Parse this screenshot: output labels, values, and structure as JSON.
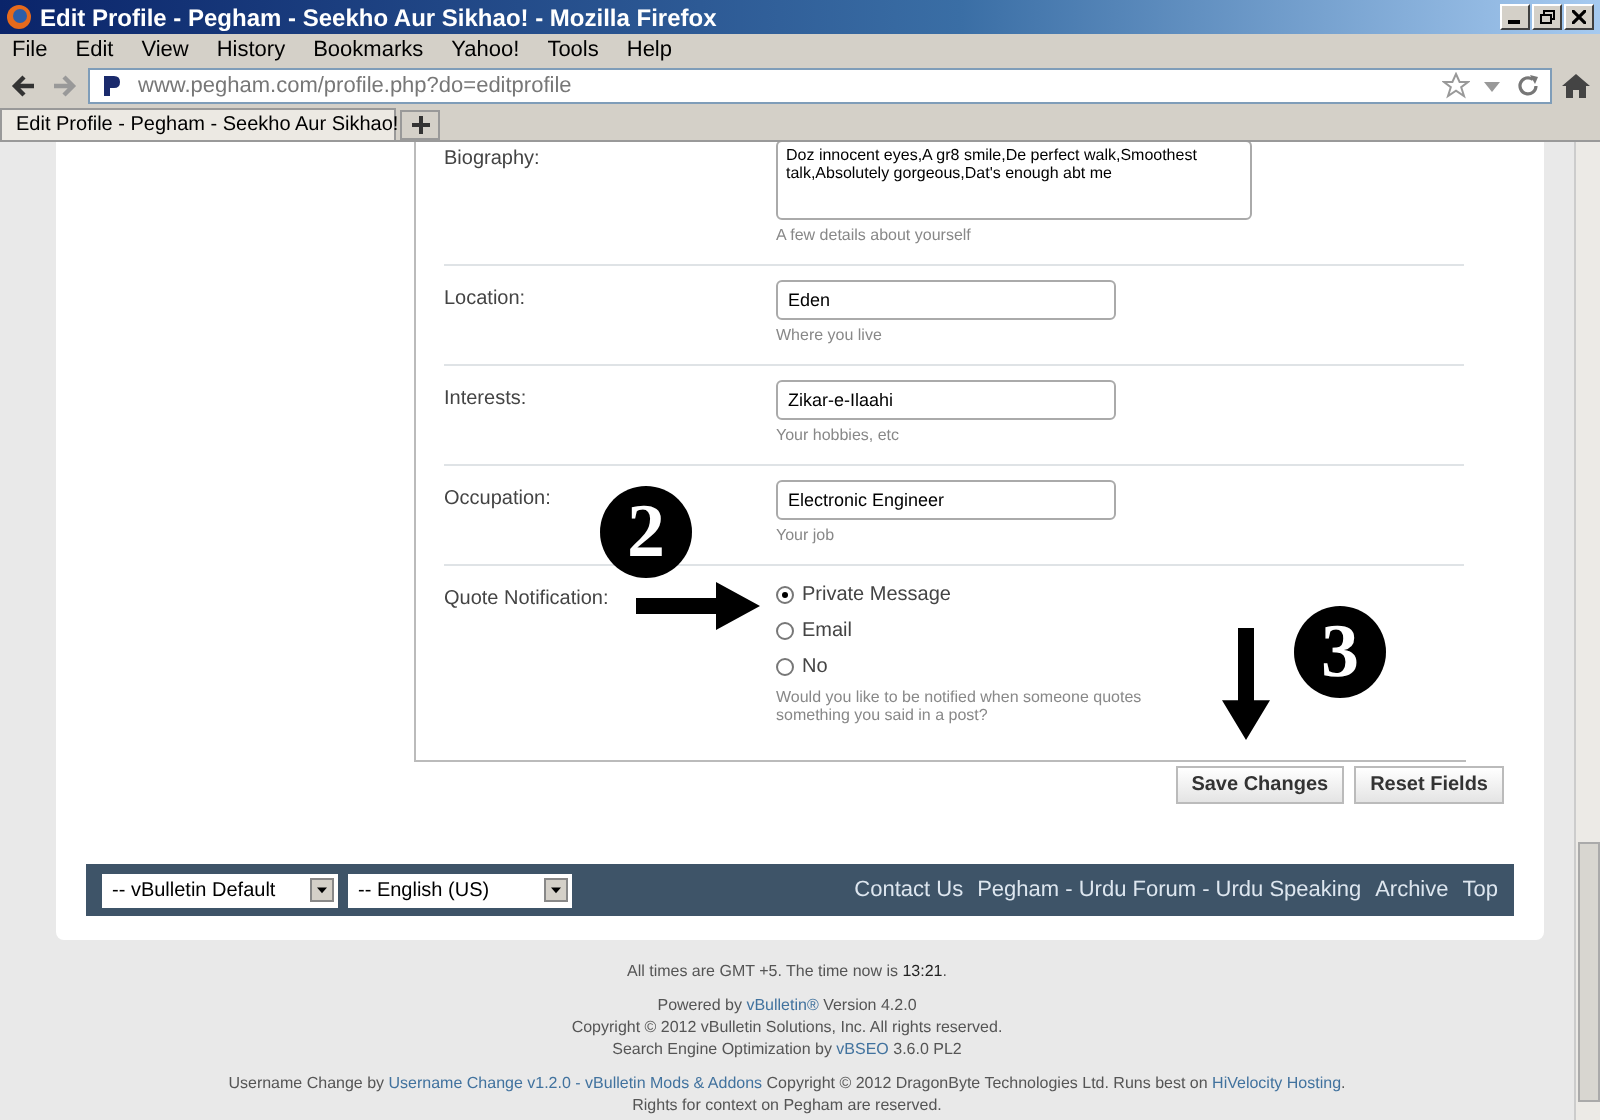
{
  "window": {
    "title": "Edit Profile - Pegham - Seekho Aur Sikhao! - Mozilla Firefox"
  },
  "menu": [
    "File",
    "Edit",
    "View",
    "History",
    "Bookmarks",
    "Yahoo!",
    "Tools",
    "Help"
  ],
  "address": {
    "url": "www.pegham.com/profile.php?do=editprofile"
  },
  "tabs": [
    {
      "label": "Edit Profile - Pegham - Seekho Aur Sikhao!",
      "selected": true
    }
  ],
  "form": {
    "rows": [
      {
        "kind": "textarea",
        "label": "Biography:",
        "value": "Doz innocent eyes,A gr8 smile,De perfect walk,Smoothest talk,Absolutely gorgeous,Dat's enough abt me",
        "hint": "A few details about yourself"
      },
      {
        "kind": "text",
        "label": "Location:",
        "value": "Eden",
        "hint": "Where you live"
      },
      {
        "kind": "text",
        "label": "Interests:",
        "value": "Zikar-e-Ilaahi",
        "hint": "Your hobbies, etc"
      },
      {
        "kind": "text",
        "label": "Occupation:",
        "value": "Electronic Engineer",
        "hint": "Your job"
      },
      {
        "kind": "radio",
        "label": "Quote Notification:",
        "options": [
          {
            "label": "Private Message",
            "selected": true
          },
          {
            "label": "Email",
            "selected": false
          },
          {
            "label": "No",
            "selected": false
          }
        ],
        "hint": "Would you like to be notified when someone quotes something you said in a post?"
      }
    ]
  },
  "buttons": [
    "Save Changes",
    "Reset Fields"
  ],
  "annotations": [
    {
      "number": "2"
    },
    {
      "number": "3"
    }
  ],
  "footer_bar": {
    "selects": [
      "-- vBulletin Default",
      "-- English (US)"
    ],
    "links": [
      "Contact Us",
      "Pegham - Urdu Forum - Urdu Speaking",
      "Archive",
      "Top"
    ]
  },
  "footer": {
    "time_note": "All times are GMT +5. The time now is **13:21**.",
    "lines": [
      [
        {
          "kind": "text",
          "text": "Powered by "
        },
        {
          "kind": "link",
          "text": "vBulletin®"
        },
        {
          "kind": "text",
          "text": " Version 4.2.0"
        }
      ],
      [
        {
          "kind": "text",
          "text": "Copyright © 2012 vBulletin Solutions, Inc. All rights reserved."
        }
      ],
      [
        {
          "kind": "text",
          "text": "Search Engine Optimization by "
        },
        {
          "kind": "link",
          "text": "vBSEO"
        },
        {
          "kind": "text",
          "text": " 3.6.0 PL2"
        }
      ],
      [
        {
          "kind": "text",
          "text": "Username Change by "
        },
        {
          "kind": "link",
          "text": "Username Change v1.2.0 - vBulletin Mods & Addons"
        },
        {
          "kind": "text",
          "text": " Copyright © 2012 DragonByte Technologies Ltd. Runs best on "
        },
        {
          "kind": "link",
          "text": "HiVelocity Hosting"
        },
        {
          "kind": "text",
          "text": "."
        }
      ],
      [
        {
          "kind": "text",
          "text": "Rights for context on Pegham are reserved."
        }
      ]
    ]
  }
}
